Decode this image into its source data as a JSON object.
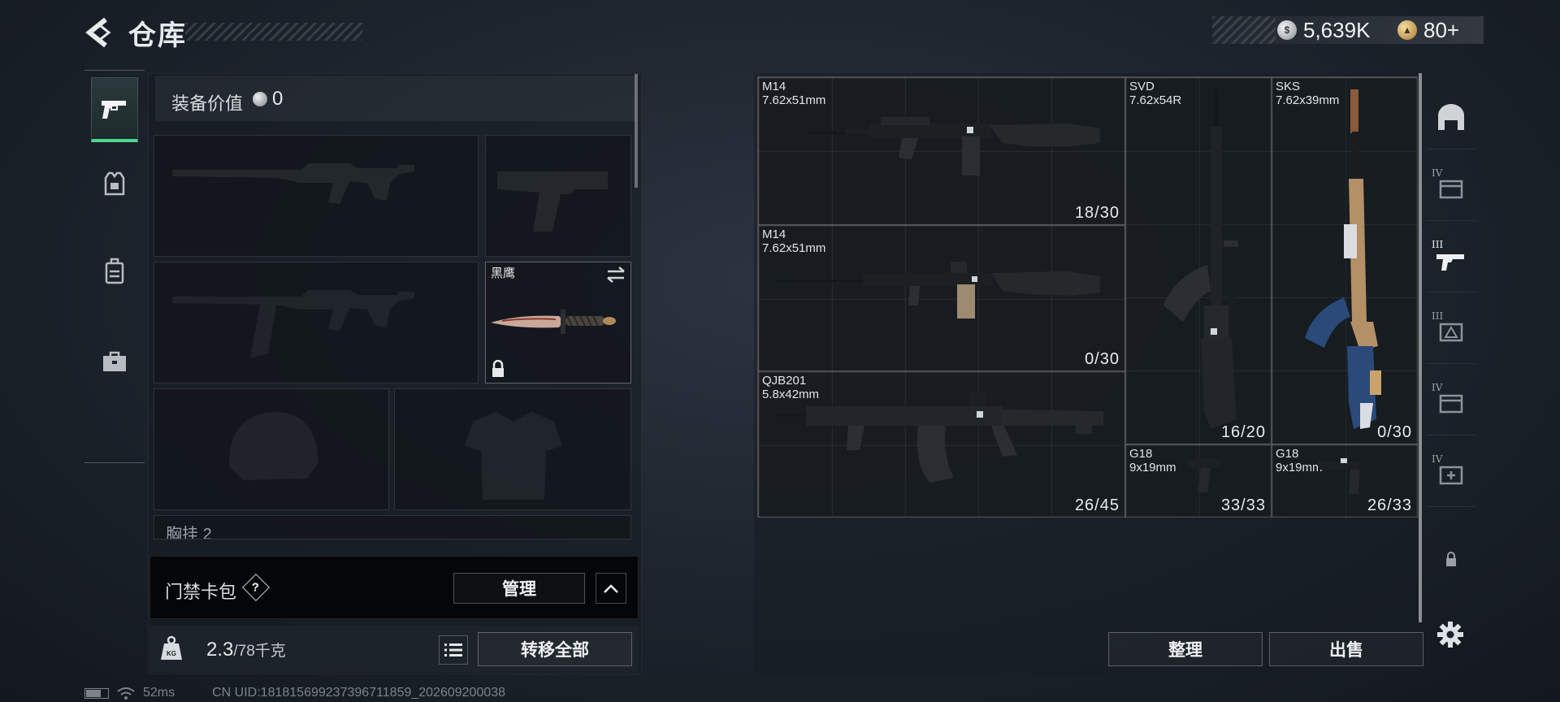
{
  "header": {
    "title": "仓库",
    "currency_silver": "5,639K",
    "currency_gold": "80+"
  },
  "left_tabs": [
    {
      "id": "weapon",
      "icon": "pistol-icon",
      "active": true
    },
    {
      "id": "armor",
      "icon": "armor-vest-icon"
    },
    {
      "id": "backpack",
      "icon": "backpack-icon"
    },
    {
      "id": "case",
      "icon": "briefcase-icon"
    }
  ],
  "equipment": {
    "value_label": "装备价值",
    "value": "0",
    "melee_name": "黑鹰",
    "rig_label": "胸挂",
    "rig_count": "2"
  },
  "access_card": {
    "label": "门禁卡包",
    "help": "?",
    "manage_label": "管理"
  },
  "weight": {
    "current": "2.3",
    "max": "/78千克",
    "transfer_all_label": "转移全部"
  },
  "status": {
    "ping": "52ms",
    "uid": "CN UID:181815699237396711859_202609200038"
  },
  "stash_items": [
    {
      "name": "M14",
      "caliber": "7.62x51mm",
      "ammo": "18/30"
    },
    {
      "name": "M14",
      "caliber": "7.62x51mm",
      "ammo": "0/30"
    },
    {
      "name": "QJB201",
      "caliber": "5.8x42mm",
      "ammo": "26/45"
    },
    {
      "name": "SVD",
      "caliber": "7.62x54R",
      "ammo": "16/20"
    },
    {
      "name": "SKS",
      "caliber": "7.62x39mm",
      "ammo": "0/30"
    },
    {
      "name": "G18",
      "caliber": "9x19mm",
      "ammo": "33/33"
    },
    {
      "name": "G18",
      "caliber": "9x19mm",
      "ammo": "26/33"
    }
  ],
  "stash_actions": {
    "sort_label": "整理",
    "sell_label": "出售"
  },
  "categories": [
    {
      "icon": "helmet-icon",
      "tier": ""
    },
    {
      "icon": "container-icon",
      "tier": "IV"
    },
    {
      "icon": "weapon-case-icon",
      "tier": "III"
    },
    {
      "icon": "supply-box-icon",
      "tier": "III"
    },
    {
      "icon": "container-icon",
      "tier": "IV"
    },
    {
      "icon": "medkit-box-icon",
      "tier": "IV"
    },
    {
      "icon": "lock-icon",
      "tier": ""
    }
  ],
  "colors": {
    "accent_green": "#4ed48e",
    "background": "#1c232c"
  }
}
